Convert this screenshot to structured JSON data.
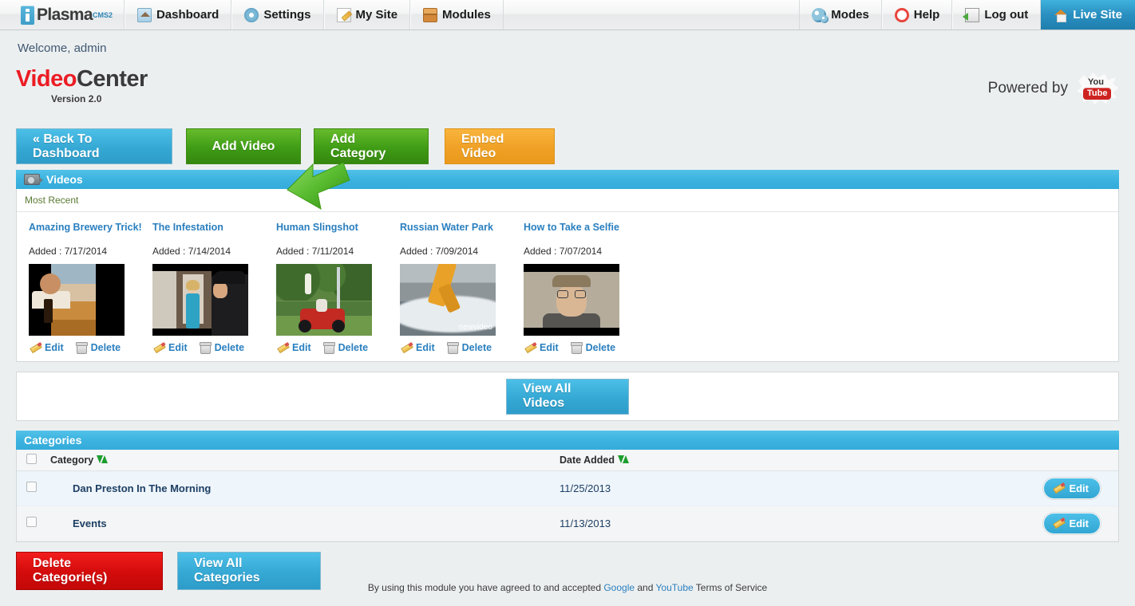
{
  "topnav": {
    "logo": {
      "text": "Plasma",
      "sup": "CMS2"
    },
    "items": [
      {
        "label": "Dashboard",
        "icon": "home-icon"
      },
      {
        "label": "Settings",
        "icon": "gear-icon"
      },
      {
        "label": "My Site",
        "icon": "pencil-note-icon"
      },
      {
        "label": "Modules",
        "icon": "box-icon"
      }
    ],
    "right_items": [
      {
        "label": "Modes",
        "icon": "modes-gears-icon"
      },
      {
        "label": "Help",
        "icon": "lifering-icon"
      },
      {
        "label": "Log out",
        "icon": "logout-door-icon"
      }
    ],
    "live_site": {
      "label": "Live Site",
      "icon": "house-icon"
    }
  },
  "page": {
    "welcome": "Welcome, admin",
    "brand_red": "Video",
    "brand_dark": "Center",
    "version": "Version 2.0",
    "powered_by": "Powered by",
    "youtube_you": "You",
    "youtube_tube": "Tube"
  },
  "toolbar": {
    "back_to_dashboard": "« Back To Dashboard",
    "add_video": "Add Video",
    "add_category": "Add Category",
    "embed_video": "Embed Video"
  },
  "videos_panel": {
    "title": "Videos",
    "icon": "video-camera-icon",
    "most_recent": "Most Recent",
    "edit_label": "Edit",
    "delete_label": "Delete",
    "items": [
      {
        "title": "Amazing Brewery Trick!",
        "added": "Added : 7/17/2014"
      },
      {
        "title": "The Infestation",
        "added": "Added : 7/14/2014"
      },
      {
        "title": "Human Slingshot",
        "added": "Added : 7/11/2014"
      },
      {
        "title": "Russian Water Park",
        "added": "Added : 7/09/2014",
        "watermark": "newvideo"
      },
      {
        "title": "How to Take a Selfie",
        "added": "Added : 7/07/2014"
      }
    ],
    "view_all": "View All Videos"
  },
  "categories_panel": {
    "title": "Categories",
    "columns": {
      "category": "Category",
      "date_added": "Date Added"
    },
    "rows": [
      {
        "name": "Dan Preston In The Morning",
        "date": "11/25/2013",
        "edit": "Edit"
      },
      {
        "name": "Events",
        "date": "11/13/2013",
        "edit": "Edit"
      }
    ],
    "delete_button": "Delete Categorie(s)",
    "view_all_button": "View All Categories"
  },
  "footer": {
    "text_start": "By using this module you have agreed to and accepted ",
    "link_google": "Google",
    "and": " and ",
    "link_youtube": "YouTube",
    "text_end": " Terms of Service"
  },
  "colors": {
    "accent_blue": "#34abda",
    "green": "#3f9c15",
    "orange": "#f0a126",
    "red": "#d30b0b",
    "brand_red": "#ec1c24",
    "link_blue": "#2a7fbf",
    "page_bg": "#eceff0"
  }
}
